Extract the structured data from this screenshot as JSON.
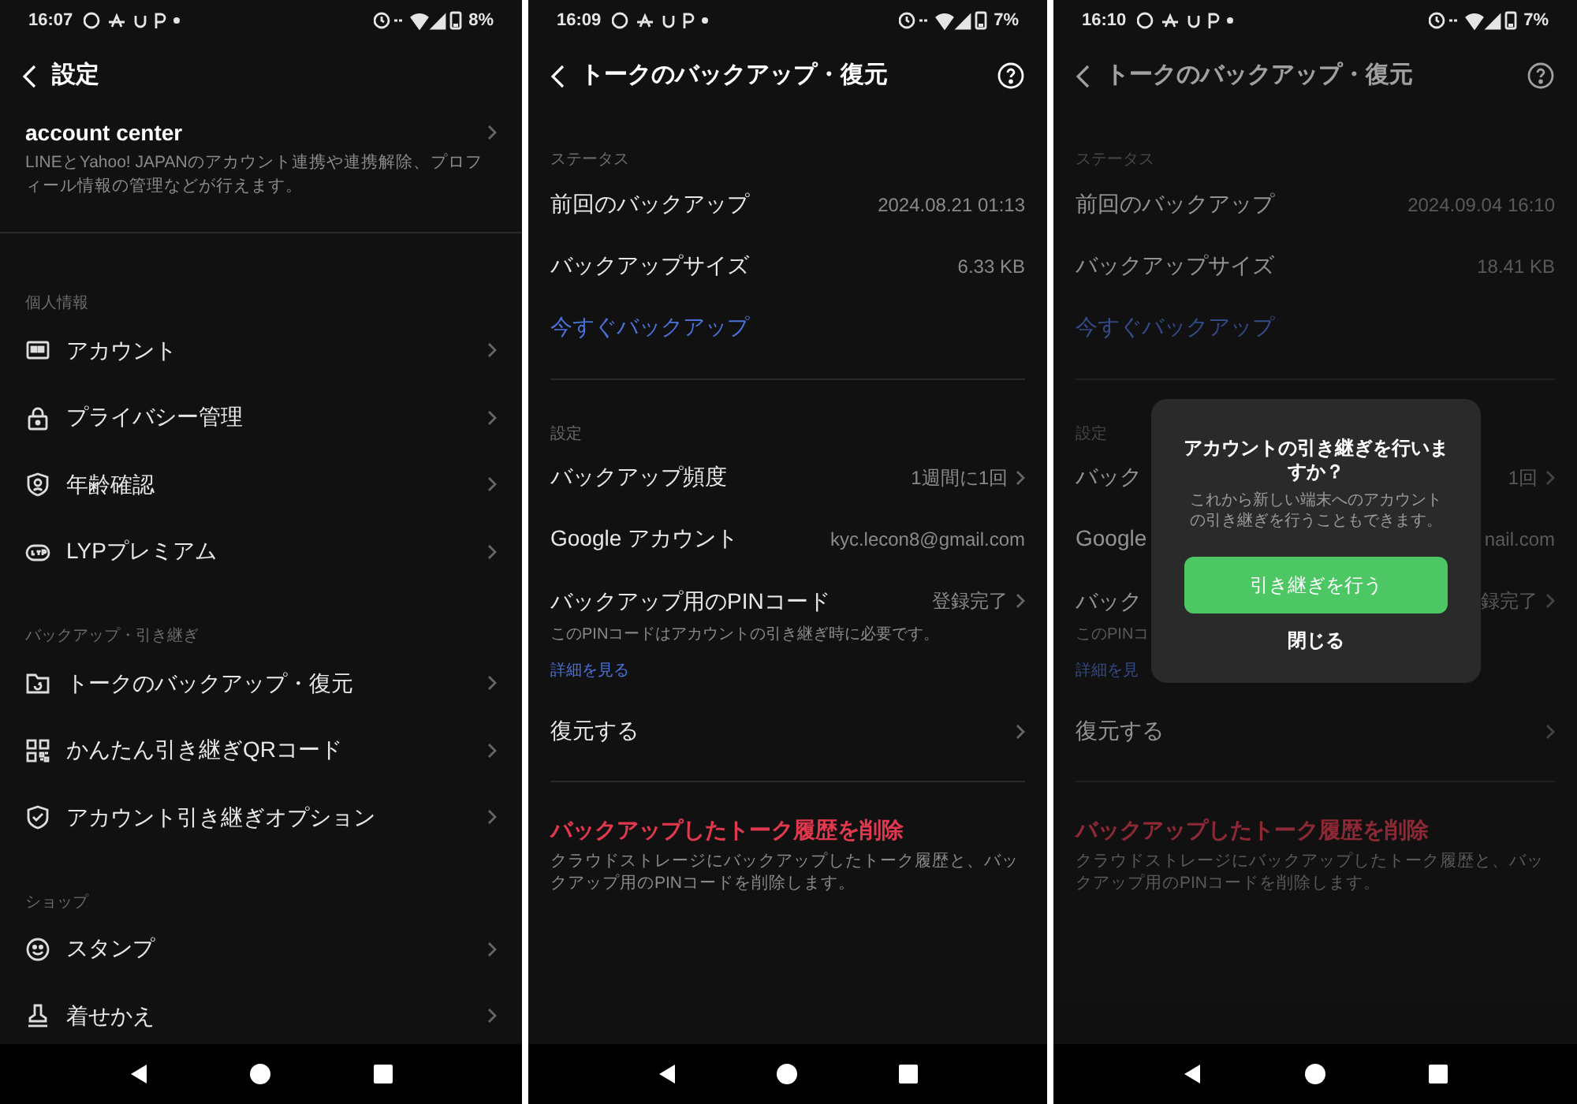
{
  "screens": [
    {
      "kind": "settings",
      "status_bar": {
        "time": "16:07",
        "battery": "8%"
      },
      "header": {
        "title": "設定"
      },
      "account_center": {
        "title": "account center",
        "description": "LINEとYahoo! JAPANのアカウント連携や連携解除、プロフィール情報の管理などが行えます。"
      },
      "sections": [
        {
          "label": "個人情報",
          "items": [
            {
              "label": "アカウント"
            },
            {
              "label": "プライバシー管理"
            },
            {
              "label": "年齢確認"
            },
            {
              "label": "LYPプレミアム"
            }
          ]
        },
        {
          "label": "バックアップ・引き継ぎ",
          "items": [
            {
              "label": "トークのバックアップ・復元"
            },
            {
              "label": "かんたん引き継ぎQRコード"
            },
            {
              "label": "アカウント引き継ぎオプション"
            }
          ]
        },
        {
          "label": "ショップ",
          "items": [
            {
              "label": "スタンプ"
            },
            {
              "label": "着せかえ"
            }
          ]
        }
      ]
    },
    {
      "kind": "backup",
      "dimmed": false,
      "status_bar": {
        "time": "16:09",
        "battery": "7%"
      },
      "header": {
        "title": "トークのバックアップ・復元"
      },
      "status_section": {
        "label": "ステータス",
        "rows": [
          {
            "label": "前回のバックアップ",
            "value": "2024.08.21 01:13"
          },
          {
            "label": "バックアップサイズ",
            "value": "6.33 KB"
          }
        ],
        "action": "今すぐバックアップ"
      },
      "settings_section": {
        "label": "設定",
        "rows": [
          {
            "label": "バックアップ頻度",
            "value": "1週間に1回",
            "chevron": true
          },
          {
            "label": "Google アカウント",
            "value": "kyc.lecon8@gmail.com",
            "chevron": false
          },
          {
            "label": "バックアップ用のPINコード",
            "value": "登録完了",
            "chevron": true,
            "note": "このPINコードはアカウントの引き継ぎ時に必要です。",
            "link": "詳細を見る"
          },
          {
            "label": "復元する",
            "chevron": true
          }
        ]
      },
      "delete": {
        "title": "バックアップしたトーク履歴を削除",
        "description": "クラウドストレージにバックアップしたトーク履歴と、バックアップ用のPINコードを削除します。"
      }
    },
    {
      "kind": "backup",
      "dimmed": true,
      "status_bar": {
        "time": "16:10",
        "battery": "7%"
      },
      "header": {
        "title": "トークのバックアップ・復元"
      },
      "status_section": {
        "label": "ステータス",
        "rows": [
          {
            "label": "前回のバックアップ",
            "value": "2024.09.04 16:10"
          },
          {
            "label": "バックアップサイズ",
            "value": "18.41 KB"
          }
        ],
        "action": "今すぐバックアップ"
      },
      "settings_section": {
        "label": "設定",
        "rows": [
          {
            "label": "バック",
            "value": "1回",
            "chevron": true
          },
          {
            "label": "Google",
            "value": "nail.com",
            "chevron": false
          },
          {
            "label": "バック",
            "value": "録完了",
            "chevron": true,
            "note": "このPINコ",
            "link": "詳細を見"
          },
          {
            "label": "復元する",
            "chevron": true
          }
        ]
      },
      "delete": {
        "title": "バックアップしたトーク履歴を削除",
        "description": "クラウドストレージにバックアップしたトーク履歴と、バックアップ用のPINコードを削除します。"
      },
      "dialog": {
        "title": "アカウントの引き継ぎを行いますか？",
        "message": "これから新しい端末へのアカウントの引き継ぎを行うこともできます。",
        "primary": "引き継ぎを行う",
        "secondary": "閉じる"
      }
    }
  ]
}
